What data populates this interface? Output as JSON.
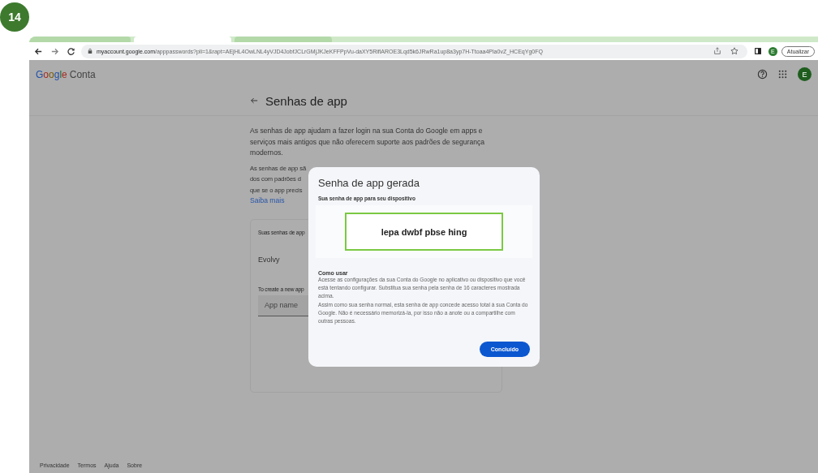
{
  "badge": "14",
  "browser": {
    "tabs": [
      {
        "selected": false
      },
      {
        "selected": true
      },
      {
        "selected": false
      }
    ],
    "url_host": "myaccount.google.com",
    "url_path": "/apppasswords?pli=1&rapt=AEjHL4OwLNL4yVJD4JobfJCLrGMjJKJeKFFPpVu-daXY5RiflAROE3Lqd5k6JRwRa1up8a3yp7H-Ttoaa4Pla0vZ_HCEqYg0FQ",
    "profile_initial": "E",
    "update_button": "Atualizar"
  },
  "header": {
    "logo": "Google",
    "product": "Conta",
    "avatar_initial": "E"
  },
  "page": {
    "title": "Senhas de app",
    "intro": "As senhas de app ajudam a fazer login na sua Conta do Google em apps e serviços mais antigos que não oferecem suporte aos padrões de segurança modernos.",
    "covered_lines": [
      "As senhas de app sã",
      "dos com padrões d",
      "que se o app precis"
    ],
    "learn_more": "Saiba mais",
    "card": {
      "heading": "Suas senhas de app",
      "app": "Evolvy",
      "create_hint": "To create a new app",
      "app_name_placeholder": "App name"
    }
  },
  "dialog": {
    "title": "Senha de app gerada",
    "subtitle": "Sua senha de app para seu dispositivo",
    "password": "lepa dwbf pbse hing",
    "howto_title": "Como usar",
    "howto_1": "Acesse as configurações da sua Conta do Google no aplicativo ou dispositivo que você está tentando configurar. Substitua sua senha pela senha de 16 caracteres mostrada acima.",
    "howto_2": "Assim como sua senha normal, esta senha de app concede acesso total à sua Conta do Google. Não é necessário memorizá-la, por isso não a anote ou a compartilhe com outras pessoas.",
    "done_button": "Concluído"
  },
  "footer": [
    "Privacidade",
    "Termos",
    "Ajuda",
    "Sobre"
  ]
}
